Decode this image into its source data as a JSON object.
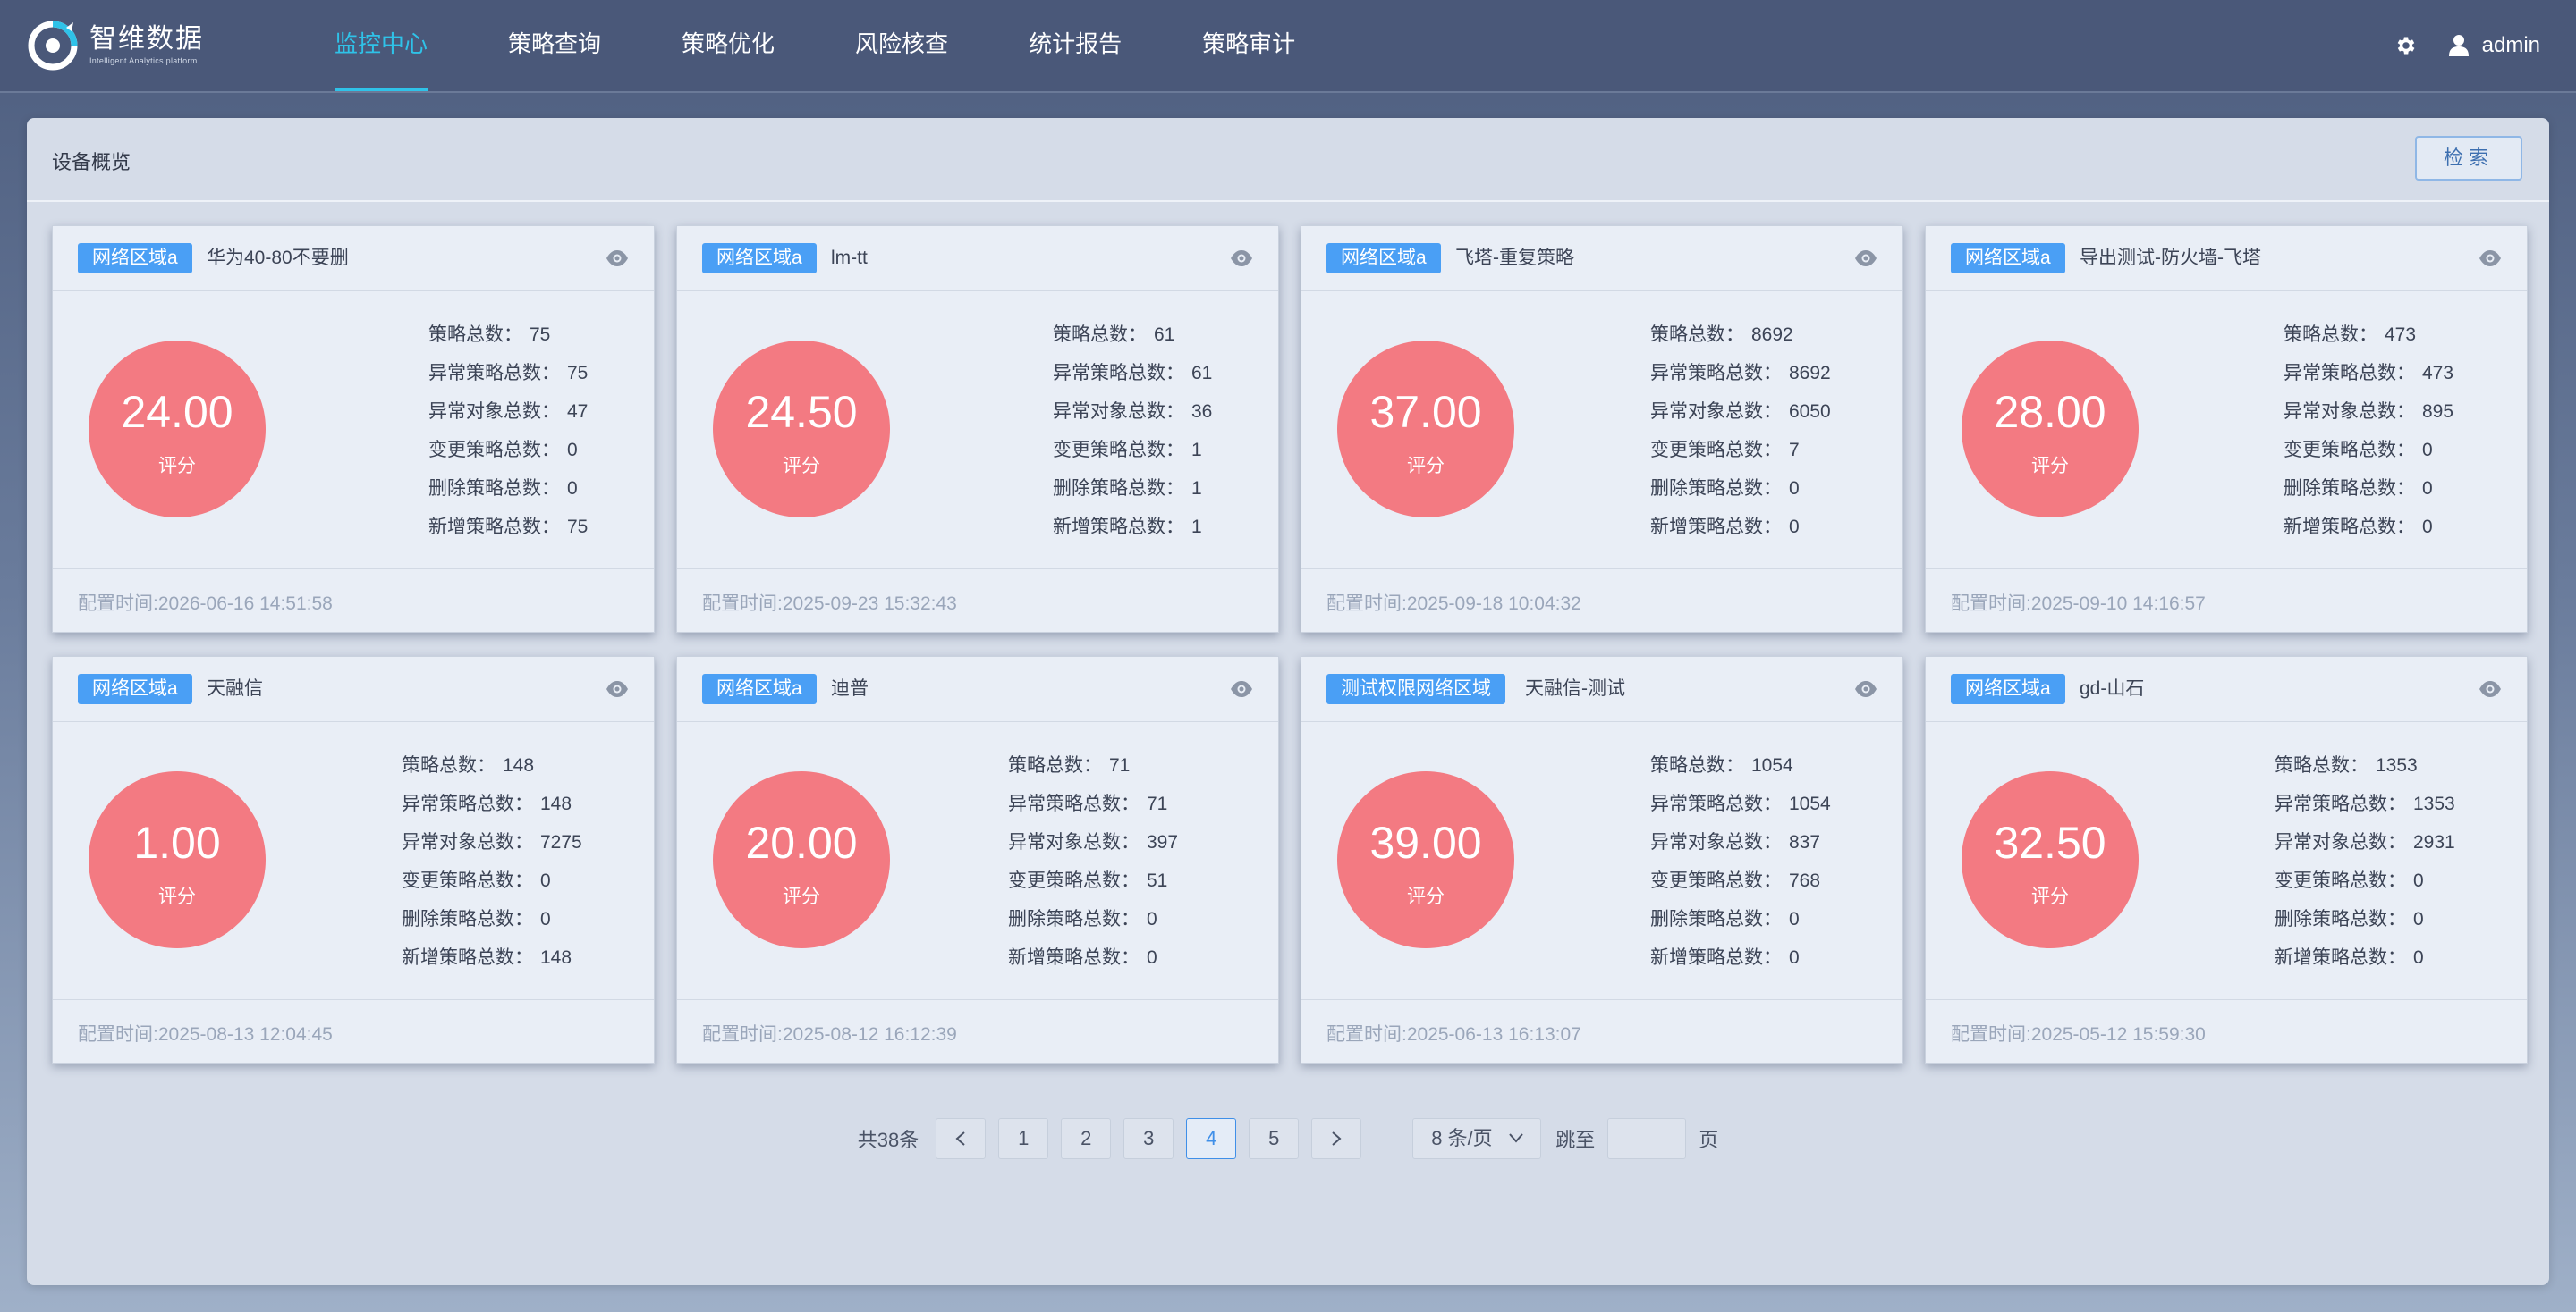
{
  "brand": {
    "title": "智维数据",
    "subtitle": "Intelligent Analytics platform"
  },
  "nav": [
    {
      "label": "监控中心",
      "active": true
    },
    {
      "label": "策略查询"
    },
    {
      "label": "策略优化"
    },
    {
      "label": "风险核查"
    },
    {
      "label": "统计报告"
    },
    {
      "label": "策略审计"
    }
  ],
  "user": {
    "name": "admin"
  },
  "panel": {
    "title": "设备概览",
    "search_label": "检索"
  },
  "score_label": "评分",
  "stat_labels": [
    "策略总数：",
    "异常策略总数：",
    "异常对象总数：",
    "变更策略总数：",
    "删除策略总数：",
    "新增策略总数："
  ],
  "cfg_prefix": "配置时间:",
  "devices": [
    {
      "tag": "网络区域a",
      "name": "华为40-80不要删",
      "score": "24.00",
      "stats": [
        "75",
        "75",
        "47",
        "0",
        "0",
        "75"
      ],
      "time": "2026-06-16 14:51:58"
    },
    {
      "tag": "网络区域a",
      "name": "lm-tt",
      "score": "24.50",
      "stats": [
        "61",
        "61",
        "36",
        "1",
        "1",
        "1"
      ],
      "time": "2025-09-23 15:32:43"
    },
    {
      "tag": "网络区域a",
      "name": "飞塔-重复策略",
      "score": "37.00",
      "stats": [
        "8692",
        "8692",
        "6050",
        "7",
        "0",
        "0"
      ],
      "time": "2025-09-18 10:04:32"
    },
    {
      "tag": "网络区域a",
      "name": "导出测试-防火墙-飞塔",
      "score": "28.00",
      "stats": [
        "473",
        "473",
        "895",
        "0",
        "0",
        "0"
      ],
      "time": "2025-09-10 14:16:57"
    },
    {
      "tag": "网络区域a",
      "name": "天融信",
      "score": "1.00",
      "stats": [
        "148",
        "148",
        "7275",
        "0",
        "0",
        "148"
      ],
      "time": "2025-08-13 12:04:45"
    },
    {
      "tag": "网络区域a",
      "name": "迪普",
      "score": "20.00",
      "stats": [
        "71",
        "71",
        "397",
        "51",
        "0",
        "0"
      ],
      "time": "2025-08-12 16:12:39"
    },
    {
      "tag": "测试权限网络区域",
      "name": "天融信-测试",
      "score": "39.00",
      "stats": [
        "1054",
        "1054",
        "837",
        "768",
        "0",
        "0"
      ],
      "time": "2025-06-13 16:13:07"
    },
    {
      "tag": "网络区域a",
      "name": "gd-山石",
      "score": "32.50",
      "stats": [
        "1353",
        "1353",
        "2931",
        "0",
        "0",
        "0"
      ],
      "time": "2025-05-12 15:59:30"
    }
  ],
  "pagination": {
    "total": "共38条",
    "prev": "<",
    "next": ">",
    "pages": [
      "1",
      "2",
      "3",
      "4",
      "5"
    ],
    "current": "4",
    "page_size": "8 条/页",
    "jump_label": "跳至",
    "jump_suffix": "页"
  },
  "colors": {
    "accent": "#2fc2e8",
    "tag": "#4a9ff5",
    "score": "#f37a82",
    "page_active": "#3f8fe8"
  }
}
